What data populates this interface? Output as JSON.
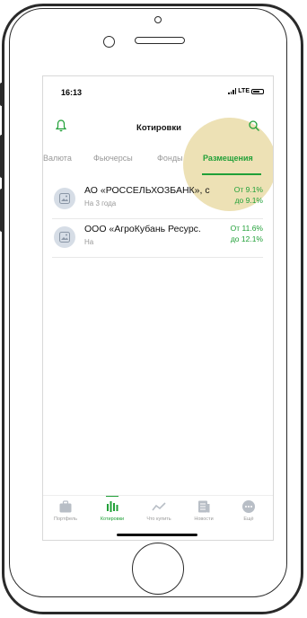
{
  "status": {
    "time": "16:13",
    "network": "LTE"
  },
  "header": {
    "title": "Котировки"
  },
  "tabs": [
    {
      "label": "Валюта"
    },
    {
      "label": "Фьючерсы"
    },
    {
      "label": "Фонды"
    },
    {
      "label": "Размещения",
      "active": true
    }
  ],
  "placements": [
    {
      "name": "АО «РОССЕЛЬХОЗБАНК», с",
      "sub": "На 3 года",
      "from": "От 9.1%",
      "to": "до 9.1%"
    },
    {
      "name": "ООО «АгроКубань Ресурс.",
      "sub": "На",
      "from": "От 11.6%",
      "to": "до 12.1%"
    }
  ],
  "bottom_nav": [
    {
      "label": "Портфель",
      "icon": "briefcase-icon"
    },
    {
      "label": "Котировки",
      "icon": "quotes-icon",
      "active": true
    },
    {
      "label": "Что купить",
      "icon": "trend-icon"
    },
    {
      "label": "Новости",
      "icon": "news-icon"
    },
    {
      "label": "Ещё",
      "icon": "more-icon"
    }
  ],
  "colors": {
    "accent": "#21a038",
    "highlight": "#dec878"
  }
}
